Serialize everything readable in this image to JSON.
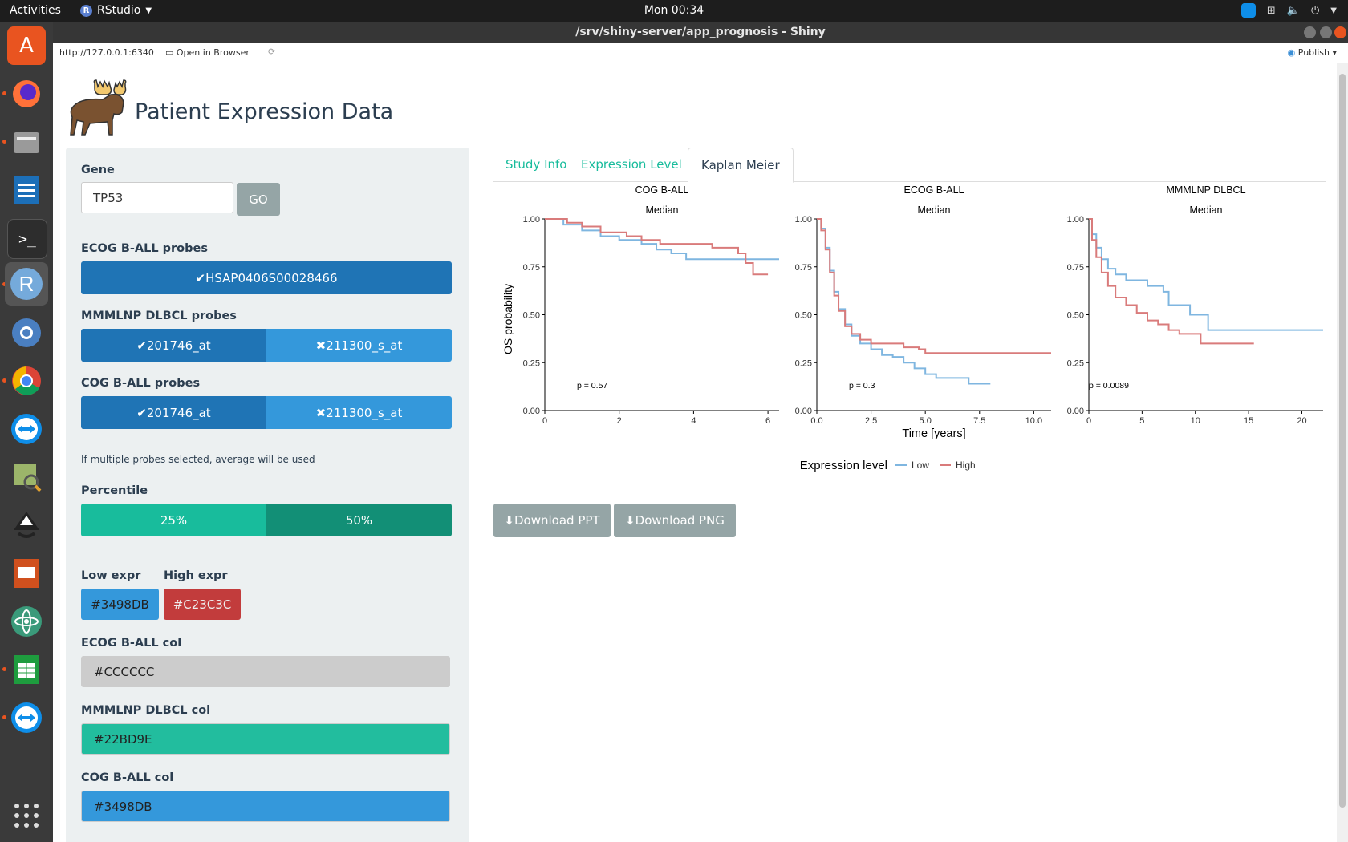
{
  "system": {
    "activities": "Activities",
    "app_name": "RStudio",
    "clock": "Mon 00:34"
  },
  "window": {
    "title": "/srv/shiny-server/app_prognosis - Shiny"
  },
  "browser": {
    "url": "http://127.0.0.1:6340",
    "open_in_browser": "Open in Browser",
    "publish": "Publish"
  },
  "app": {
    "title": "Patient Expression Data"
  },
  "sidebar": {
    "gene_label": "Gene",
    "gene_value": "TP53",
    "go_label": "GO",
    "ecog_probes_label": "ECOG B-ALL probes",
    "ecog_probes": [
      {
        "label": "HSAP0406S00028466",
        "selected": true
      }
    ],
    "mmmlnp_probes_label": "MMMLNP DLBCL probes",
    "mmmlnp_probes": [
      {
        "label": "201746_at",
        "selected": true
      },
      {
        "label": "211300_s_at",
        "selected": false
      }
    ],
    "cog_probes_label": "COG B-ALL probes",
    "cog_probes": [
      {
        "label": "201746_at",
        "selected": true
      },
      {
        "label": "211300_s_at",
        "selected": false
      }
    ],
    "multi_note": "If multiple probes selected, average will be used",
    "percentile_label": "Percentile",
    "percentile_options": [
      {
        "label": "25%",
        "selected": false
      },
      {
        "label": "50%",
        "selected": true
      }
    ],
    "low_expr_label": "Low expr",
    "high_expr_label": "High expr",
    "low_expr_color": "#3498DB",
    "high_expr_color": "#C23C3C",
    "ecog_col_label": "ECOG B-ALL col",
    "ecog_col": "#CCCCCC",
    "mmmlnp_col_label": "MMMLNP DLBCL col",
    "mmmlnp_col": "#22BD9E",
    "cog_col_label": "COG B-ALL col",
    "cog_col": "#3498DB"
  },
  "tabs": [
    {
      "label": "Study Info",
      "active": false
    },
    {
      "label": "Expression Level",
      "active": false
    },
    {
      "label": "Kaplan Meier",
      "active": true
    }
  ],
  "buttons": {
    "download_ppt": "Download PPT",
    "download_png": "Download PNG"
  },
  "chart_data": {
    "type": "line",
    "ylabel": "OS probability",
    "xlabel": "Time [years]",
    "legend_title": "Expression level",
    "legend_position": "bottom",
    "low_color": "#7fb6e0",
    "high_color": "#d97b7b",
    "panels": [
      {
        "title": "COG B-ALL",
        "subtitle": "Median",
        "pvalue": "p = 0.57",
        "xlim": [
          0,
          6.3
        ],
        "xticks": [
          "0",
          "2",
          "4",
          "6"
        ],
        "xtick_values": [
          0,
          2,
          4,
          6
        ],
        "ylim": [
          0,
          1
        ],
        "yticks": [
          "0.00",
          "0.25",
          "0.50",
          "0.75",
          "1.00"
        ],
        "series": [
          {
            "name": "Low",
            "x": [
              0,
              0.5,
              1.0,
              1.5,
              2.0,
              2.6,
              3.0,
              3.4,
              3.8,
              4.5,
              5.5,
              6.3
            ],
            "y": [
              1.0,
              0.97,
              0.94,
              0.91,
              0.89,
              0.87,
              0.84,
              0.82,
              0.79,
              0.79,
              0.79,
              0.79
            ]
          },
          {
            "name": "High",
            "x": [
              0,
              0.6,
              1.0,
              1.5,
              2.2,
              2.6,
              3.1,
              4.1,
              4.5,
              5.2,
              5.4,
              5.6,
              6.0
            ],
            "y": [
              1.0,
              0.98,
              0.96,
              0.93,
              0.91,
              0.89,
              0.87,
              0.87,
              0.85,
              0.82,
              0.77,
              0.71,
              0.71
            ]
          }
        ]
      },
      {
        "title": "ECOG B-ALL",
        "subtitle": "Median",
        "pvalue": "p = 0.3",
        "xlim": [
          0,
          10.8
        ],
        "xticks": [
          "0.0",
          "2.5",
          "5.0",
          "7.5",
          "10.0"
        ],
        "xtick_values": [
          0,
          2.5,
          5,
          7.5,
          10
        ],
        "ylim": [
          0,
          1
        ],
        "yticks": [
          "0.00",
          "0.25",
          "0.50",
          "0.75",
          "1.00"
        ],
        "series": [
          {
            "name": "Low",
            "x": [
              0,
              0.2,
              0.4,
              0.6,
              0.8,
              1.0,
              1.3,
              1.6,
              2.0,
              2.5,
              3.0,
              3.5,
              4.0,
              4.5,
              5.0,
              5.5,
              6.5,
              7.0,
              8.0
            ],
            "y": [
              1.0,
              0.95,
              0.85,
              0.73,
              0.62,
              0.53,
              0.45,
              0.39,
              0.35,
              0.32,
              0.29,
              0.28,
              0.25,
              0.22,
              0.19,
              0.17,
              0.17,
              0.14,
              0.14
            ]
          },
          {
            "name": "High",
            "x": [
              0,
              0.2,
              0.4,
              0.6,
              0.8,
              1.0,
              1.3,
              1.6,
              2.0,
              2.5,
              3.5,
              4.0,
              4.7,
              5.0,
              10.8
            ],
            "y": [
              1.0,
              0.94,
              0.84,
              0.72,
              0.6,
              0.52,
              0.44,
              0.4,
              0.37,
              0.35,
              0.35,
              0.33,
              0.32,
              0.3,
              0.3
            ]
          }
        ]
      },
      {
        "title": "MMMLNP DLBCL",
        "subtitle": "Median",
        "pvalue": "p = 0.0089",
        "xlim": [
          0,
          22
        ],
        "xticks": [
          "0",
          "5",
          "10",
          "15",
          "20"
        ],
        "xtick_values": [
          0,
          5,
          10,
          15,
          20
        ],
        "ylim": [
          0,
          1
        ],
        "yticks": [
          "0.00",
          "0.25",
          "0.50",
          "0.75",
          "1.00"
        ],
        "series": [
          {
            "name": "Low",
            "x": [
              0,
              0.3,
              0.7,
              1.2,
              1.8,
              2.5,
              3.5,
              5.5,
              7.0,
              7.5,
              8.5,
              9.5,
              11.0,
              11.2,
              22.0
            ],
            "y": [
              1.0,
              0.92,
              0.85,
              0.79,
              0.74,
              0.71,
              0.68,
              0.65,
              0.62,
              0.55,
              0.55,
              0.5,
              0.5,
              0.42,
              0.42
            ]
          },
          {
            "name": "High",
            "x": [
              0,
              0.3,
              0.7,
              1.2,
              1.8,
              2.5,
              3.5,
              4.5,
              5.5,
              6.5,
              7.5,
              8.5,
              10.0,
              10.5,
              15.5
            ],
            "y": [
              1.0,
              0.89,
              0.8,
              0.72,
              0.65,
              0.59,
              0.55,
              0.51,
              0.47,
              0.45,
              0.42,
              0.4,
              0.4,
              0.35,
              0.35
            ]
          }
        ]
      }
    ]
  }
}
